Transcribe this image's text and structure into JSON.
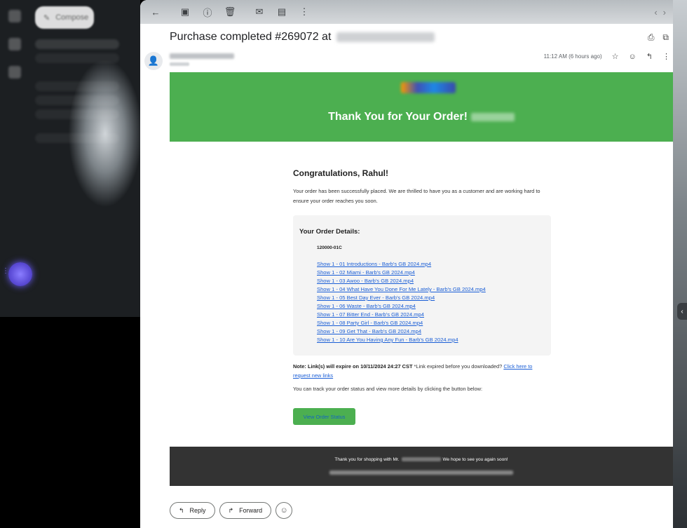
{
  "toolbar": {
    "back_icon": "arrow-left-icon",
    "archive_icon": "archive-icon",
    "report_icon": "report-spam-icon",
    "delete_icon": "trash-icon",
    "unread_icon": "mail-icon",
    "move_icon": "folder-icon",
    "more_icon": "more-vert-icon",
    "prev_icon": "chevron-left-icon",
    "next_icon": "chevron-right-icon"
  },
  "sidebar": {
    "compose_label": "Compose"
  },
  "subject": {
    "text": "Purchase completed #269072 at"
  },
  "message": {
    "timestamp": "11:12 AM (6 hours ago)"
  },
  "email": {
    "banner_title": "Thank You for Your Order!",
    "greeting": "Congratulations, Rahul!",
    "intro": "Your order has been successfully placed. We are thrilled to have you as a customer and are working hard to ensure your order reaches you soon.",
    "details_title": "Your Order Details:",
    "sku": "120000-01C",
    "items": [
      "Show 1 - 01 Introductions - Barb's GB 2024.mp4",
      "Show 1 - 02 Miami - Barb's GB 2024.mp4",
      "Show 1 - 03 Awoo - Barb's GB 2024.mp4",
      "Show 1 - 04 What Have You Done For Me Lately - Barb's GB 2024.mp4",
      "Show 1 - 05 Best Day Ever - Barb's GB 2024.mp4",
      "Show 1 - 06 Waste - Barb's GB 2024.mp4",
      "Show 1 - 07 Bitter End - Barb's GB 2024.mp4",
      "Show 1 - 08 Party Girl - Barb's GB 2024.mp4",
      "Show 1 - 09 Get That - Barb's GB 2024.mp4",
      "Show 1 - 10 Are You Having Any Fun - Barb's GB 2024.mp4"
    ],
    "note_bold": "Note: Link(s) will expire on 10/11/2024 24:27 CST",
    "note_text": " *Link expired before you downloaded? ",
    "note_link": "Click here to request new links",
    "track_text": "You can track your order status and view more details by clicking the button below:",
    "status_button": "View Order Status",
    "footer_prefix": "Thank you for shopping with Mr.",
    "footer_suffix": "We hope to see you again soon!",
    "brand_color": "#4caf50",
    "footer_color": "#333333"
  },
  "actions": {
    "reply": "Reply",
    "forward": "Forward"
  }
}
